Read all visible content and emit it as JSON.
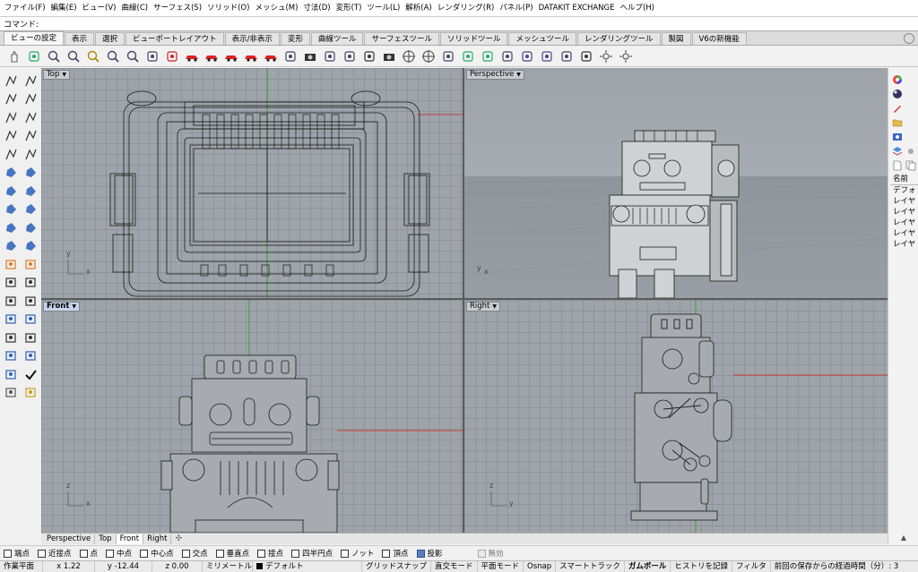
{
  "menu": [
    "ファイル(F)",
    "編集(E)",
    "ビュー(V)",
    "曲線(C)",
    "サーフェス(S)",
    "ソリッド(O)",
    "メッシュ(M)",
    "寸法(D)",
    "変形(T)",
    "ツール(L)",
    "解析(A)",
    "レンダリング(R)",
    "パネル(P)",
    "DATAKIT EXCHANGE",
    "ヘルプ(H)"
  ],
  "command": {
    "label": "コマンド:",
    "value": ""
  },
  "tabs": [
    "ビューの設定",
    "表示",
    "選択",
    "ビューポートレイアウト",
    "表示/非表示",
    "変形",
    "曲線ツール",
    "サーフェスツール",
    "ソリッドツール",
    "メッシュツール",
    "レンダリングツール",
    "製図",
    "V6の新機能"
  ],
  "active_tab": "ビューの設定",
  "toolbar_icons": [
    "pan-icon",
    "rotate-icon",
    "zoom-window-icon",
    "zoom-dynamic-icon",
    "zoom-extents-icon",
    "zoom-selected-icon",
    "zoom-all-icon",
    "undo-view-icon",
    "set-view-icon",
    "car-red-1-icon",
    "car-red-2-icon",
    "car-red-3-icon",
    "car-red-4-icon",
    "car-red-5-icon",
    "named-view-icon",
    "camera-icon",
    "capture-icon",
    "print-icon",
    "render-icon",
    "rotate-camera-icon",
    "target-icon",
    "target-2-icon",
    "object-icon",
    "cplane-icon",
    "plane-icon",
    "align-icon",
    "plane-flip-icon",
    "view-plane-icon",
    "lens-icon",
    "walk-icon",
    "light-icon",
    "sun-icon"
  ],
  "left_tools": [
    "select-arrow-icon",
    "point-icon",
    "polyline-icon",
    "curve-icon",
    "circle-icon",
    "ellipse-icon",
    "arc-icon",
    "rectangle-icon",
    "polygon-icon",
    "freeform-icon",
    "surface-icon",
    "patch-icon",
    "extrude-icon",
    "loft-icon",
    "box-icon",
    "sphere-icon",
    "cylinder-icon",
    "torus-icon",
    "mesh-icon",
    "mesh-plane-icon",
    "explode-icon",
    "join-icon",
    "trim-icon",
    "split-icon",
    "fillet-icon",
    "chamfer-icon",
    "transform-icon",
    "move-icon",
    "dimension-icon",
    "text-icon",
    "block-icon",
    "group-icon",
    "analyze-icon",
    "check-icon",
    "render-icon-l",
    "material-icon"
  ],
  "viewports": {
    "top": {
      "label": "Top",
      "axis_x": "x",
      "axis_y": "y"
    },
    "perspective": {
      "label": "Perspective",
      "axis_x": "x",
      "axis_y": "y"
    },
    "front": {
      "label": "Front",
      "axis_x": "x",
      "axis_y": "z"
    },
    "right": {
      "label": "Right",
      "axis_x": "y",
      "axis_y": "z"
    }
  },
  "viewport_tabs": [
    "Perspective",
    "Top",
    "Front",
    "Right"
  ],
  "active_viewport_tab": "Front",
  "right_panel": {
    "icons": [
      "color-wheel-icon",
      "material-ball-icon",
      "pen-icon",
      "folder-icon",
      "display-icon",
      "layers-icon",
      "document-icon",
      "copy-icon",
      "sun-icon"
    ],
    "list_header": "名前",
    "items": [
      "デフォ",
      "レイヤ",
      "レイヤ",
      "レイヤ",
      "レイヤ",
      "レイヤ"
    ]
  },
  "osnap": [
    {
      "label": "端点",
      "checked": false
    },
    {
      "label": "近接点",
      "checked": false
    },
    {
      "label": "点",
      "checked": false
    },
    {
      "label": "中点",
      "checked": false
    },
    {
      "label": "中心点",
      "checked": false
    },
    {
      "label": "交点",
      "checked": false
    },
    {
      "label": "垂直点",
      "checked": false
    },
    {
      "label": "接点",
      "checked": false
    },
    {
      "label": "四半円点",
      "checked": false
    },
    {
      "label": "ノット",
      "checked": false
    },
    {
      "label": "頂点",
      "checked": false
    },
    {
      "label": "投影",
      "checked": true
    },
    {
      "label": "無効",
      "checked": false,
      "disabled": true
    }
  ],
  "status": {
    "cplane": "作業平面",
    "x": "x 1.22",
    "y": "y -12.44",
    "z": "z 0.00",
    "unit": "ミリメートル",
    "layer": "デフォルト",
    "grid_snap": "グリッドスナップ",
    "ortho": "直交モード",
    "planar": "平面モード",
    "osnap": "Osnap",
    "smarttrack": "スマートトラック",
    "gumball": "ガムボール",
    "history": "ヒストリを記録",
    "filter": "フィルタ",
    "elapsed": "前回の保存からの経過時間（分）: 3"
  },
  "colors": {
    "viewport_bg": "#9fa4aa",
    "grid": "#8e949a",
    "x_axis": "#c23b3b",
    "y_axis": "#3b9a3b",
    "wire": "#1a1a1a",
    "active_label": "#c4d4ea"
  }
}
